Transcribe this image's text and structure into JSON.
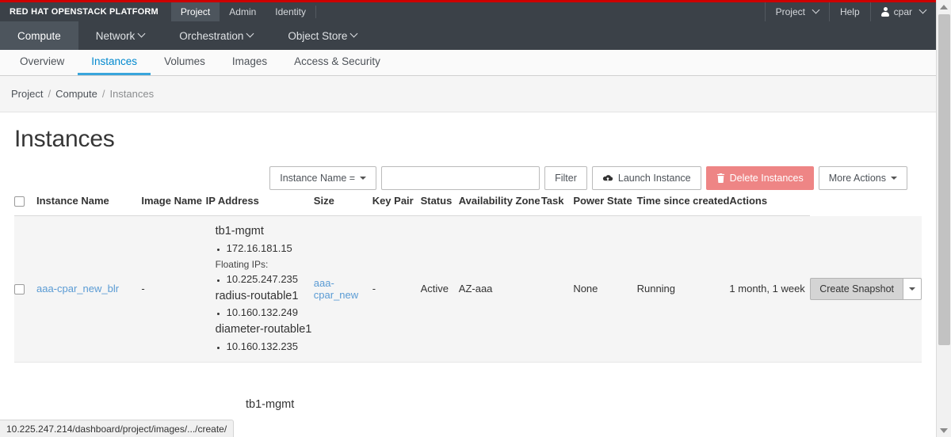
{
  "brand": {
    "title": "RED HAT OPENSTACK PLATFORM"
  },
  "topnav": {
    "items": [
      {
        "label": "Project",
        "active": true
      },
      {
        "label": "Admin",
        "active": false
      },
      {
        "label": "Identity",
        "active": false
      }
    ]
  },
  "topright": {
    "project_label": "Project",
    "help_label": "Help",
    "user_label": "cpar",
    "user_icon": "user-icon"
  },
  "mainnav": {
    "items": [
      {
        "label": "Compute",
        "active": true,
        "has_caret": false
      },
      {
        "label": "Network",
        "active": false,
        "has_caret": true
      },
      {
        "label": "Orchestration",
        "active": false,
        "has_caret": true
      },
      {
        "label": "Object Store",
        "active": false,
        "has_caret": true
      }
    ]
  },
  "tabs": [
    {
      "label": "Overview",
      "active": false
    },
    {
      "label": "Instances",
      "active": true
    },
    {
      "label": "Volumes",
      "active": false
    },
    {
      "label": "Images",
      "active": false
    },
    {
      "label": "Access & Security",
      "active": false
    }
  ],
  "breadcrumb": {
    "items": [
      "Project",
      "Compute",
      "Instances"
    ],
    "separator": "/"
  },
  "page": {
    "title": "Instances"
  },
  "toolbar": {
    "filter_select_label": "Instance Name =",
    "filter_input_value": "",
    "filter_input_placeholder": "",
    "filter_button": "Filter",
    "launch_button": "Launch Instance",
    "launch_icon": "cloud-upload-icon",
    "delete_button": "Delete Instances",
    "delete_icon": "trash-icon",
    "more_actions_button": "More Actions",
    "delete_button_color": "#ee8585"
  },
  "table": {
    "columns": [
      "Instance Name",
      "Image Name",
      "IP Address",
      "Size",
      "Key Pair",
      "Status",
      "Availability Zone",
      "Task",
      "Power State",
      "Time since created",
      "Actions"
    ],
    "rows": [
      {
        "selected": false,
        "instance_name": "aaa-cpar_new_blr",
        "image_name": "-",
        "networks": [
          {
            "name": "tb1-mgmt",
            "ips": [
              "172.16.181.15"
            ],
            "floating_label": "Floating IPs:",
            "floating_ips": [
              "10.225.247.235"
            ]
          },
          {
            "name": "radius-routable1",
            "ips": [
              "10.160.132.249"
            ],
            "floating_label": "",
            "floating_ips": []
          },
          {
            "name": "diameter-routable1",
            "ips": [
              "10.160.132.235"
            ],
            "floating_label": "",
            "floating_ips": []
          }
        ],
        "size": "aaa-cpar_new",
        "key_pair": "-",
        "status": "Active",
        "availability_zone": "AZ-aaa",
        "task": "None",
        "power_state": "Running",
        "time_since_created": "1 month, 1 week",
        "action_primary": "Create Snapshot",
        "action_caret": "caret-down-icon"
      }
    ],
    "next_row_partial": {
      "network_name": "tb1-mgmt"
    }
  },
  "statusbar": {
    "url": "10.225.247.214/dashboard/project/images/.../create/"
  },
  "scrollbar": {
    "up_icon": "scroll-up-arrow",
    "down_icon": "scroll-down-arrow"
  }
}
